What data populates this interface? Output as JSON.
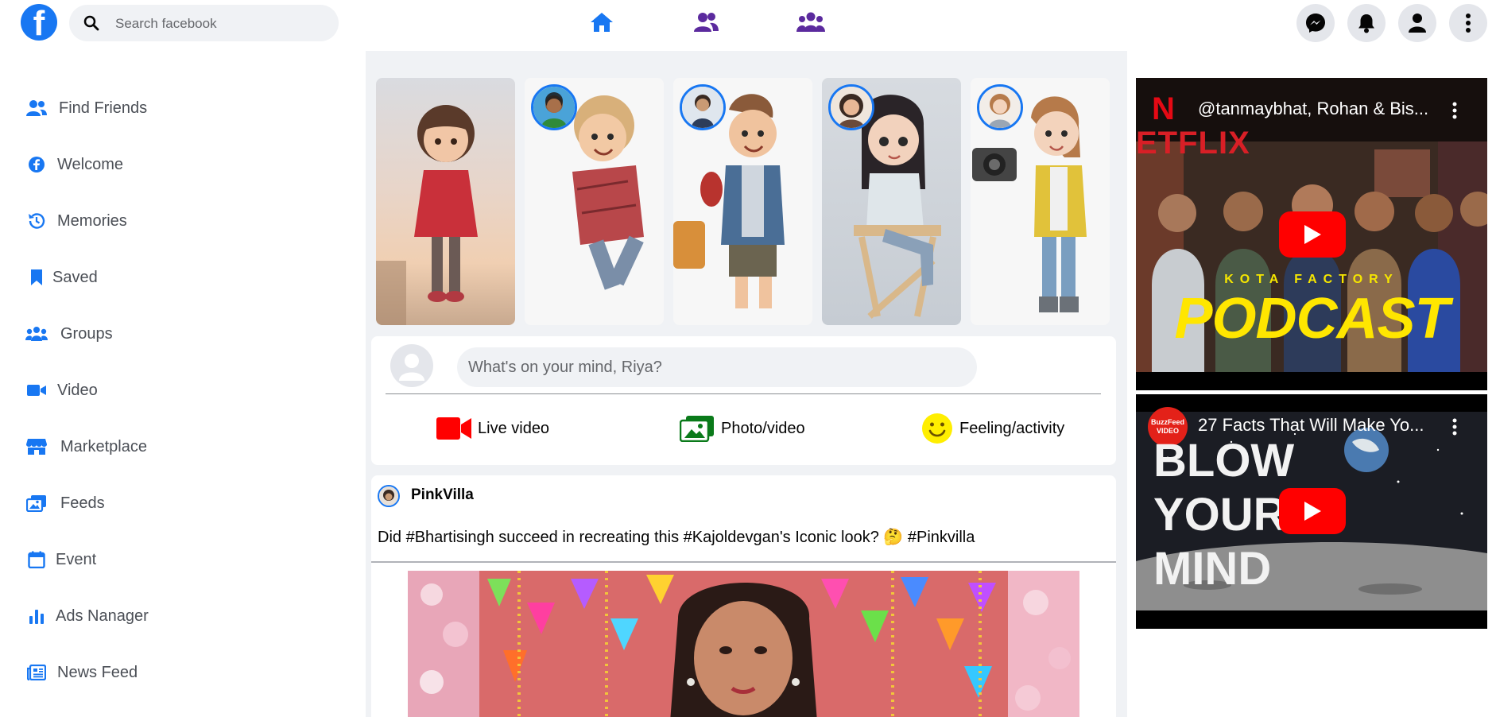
{
  "topbar": {
    "logo_letter": "f",
    "search_placeholder": "Search facebook",
    "nav": [
      "home-icon",
      "friends-icon",
      "groups-icon"
    ],
    "actions": [
      "messenger-icon",
      "bell-icon",
      "profile-icon",
      "menu-icon"
    ]
  },
  "sidebar": {
    "items": [
      {
        "label": "Find Friends",
        "icon": "friends-icon"
      },
      {
        "label": "Welcome",
        "icon": "facebook-icon"
      },
      {
        "label": "Memories",
        "icon": "history-icon"
      },
      {
        "label": "Saved",
        "icon": "bookmark-icon"
      },
      {
        "label": "Groups",
        "icon": "groups-icon"
      },
      {
        "label": "Video",
        "icon": "video-icon"
      },
      {
        "label": "Marketplace",
        "icon": "store-icon"
      },
      {
        "label": "Feeds",
        "icon": "feeds-icon"
      },
      {
        "label": "Event",
        "icon": "calendar-icon"
      },
      {
        "label": "Ads Nanager",
        "icon": "bar-chart-icon"
      },
      {
        "label": "News Feed",
        "icon": "newspaper-icon"
      }
    ]
  },
  "composer": {
    "placeholder": "What's on your mind, Riya?",
    "actions": [
      {
        "label": "Live video",
        "icon": "live-video-icon"
      },
      {
        "label": "Photo/video",
        "icon": "photo-icon"
      },
      {
        "label": "Feeling/activity",
        "icon": "smiley-icon"
      }
    ]
  },
  "post": {
    "author": "PinkVilla",
    "text": "Did #Bhartisingh succeed in recreating this #Kajoldevgan's Iconic look? 🤔 #Pinkvilla"
  },
  "videos": [
    {
      "title": "@tanmaybhat, Rohan & Bis...",
      "channel_badge": "N",
      "overlay_small": "KOTA FACTORY",
      "overlay_big": "PODCAST",
      "watermark": "ETFLIX"
    },
    {
      "title": "27 Facts That Will Make Yo...",
      "channel_badge": "BuzzFeed VIDEO",
      "overlay_lines": [
        "BLOW",
        "YOUR",
        "MIND"
      ]
    }
  ],
  "colors": {
    "brand": "#1877f2",
    "accent_purple": "#5b2a9e",
    "youtube_red": "#ff0000",
    "live_red": "#f02849",
    "photo_green": "#45bd62",
    "feeling_yellow": "#f7d30e"
  }
}
